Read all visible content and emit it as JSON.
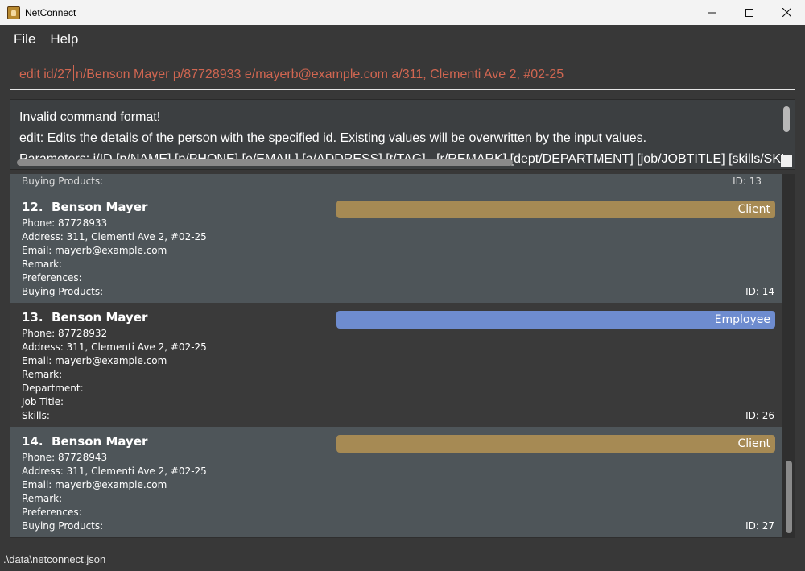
{
  "window": {
    "title": "NetConnect"
  },
  "menu": {
    "file": "File",
    "help": "Help"
  },
  "command": {
    "before_caret": "edit id/27",
    "after_caret": "n/Benson Mayer p/87728933 e/mayerb@example.com a/311, Clementi Ave 2, #02-25"
  },
  "result": {
    "line1": "Invalid command format!",
    "line2": "edit: Edits the details of the person with the specified id. Existing values will be overwritten by the input values.",
    "line3": "Parameters: i/ID [n/NAME] [p/PHONE] [e/EMAIL] [a/ADDRESS] [t/TAG]...[r/REMARK] [dept/DEPARTMENT] [job/JOBTITLE] [skills/SKI"
  },
  "list": {
    "partial_top": {
      "label": "Buying Products:",
      "id": "ID: 13"
    },
    "cards": [
      {
        "index": "12.",
        "name": "Benson Mayer",
        "tag": "Client",
        "phone": "Phone: 87728933",
        "address": "Address: 311, Clementi Ave 2, #02-25",
        "email": "Email: mayerb@example.com",
        "remark": "Remark:",
        "preferences": "Preferences:",
        "buying": "Buying Products:",
        "id": "ID: 14"
      },
      {
        "index": "13.",
        "name": "Benson Mayer",
        "tag": "Employee",
        "phone": "Phone: 87728932",
        "address": "Address: 311, Clementi Ave 2, #02-25",
        "email": "Email: mayerb@example.com",
        "remark": "Remark:",
        "department": "Department:",
        "job": "Job Title:",
        "skills": "Skills:",
        "id": "ID: 26"
      },
      {
        "index": "14.",
        "name": "Benson Mayer",
        "tag": "Client",
        "phone": "Phone: 87728943",
        "address": "Address: 311, Clementi Ave 2, #02-25",
        "email": "Email: mayerb@example.com",
        "remark": "Remark:",
        "preferences": "Preferences:",
        "buying": "Buying Products:",
        "id": "ID: 27"
      }
    ]
  },
  "status": {
    "path": ".\\data\\netconnect.json"
  },
  "colors": {
    "client_tag": "#a68a54",
    "employee_tag": "#6e8ccf",
    "command_text": "#d06651"
  }
}
